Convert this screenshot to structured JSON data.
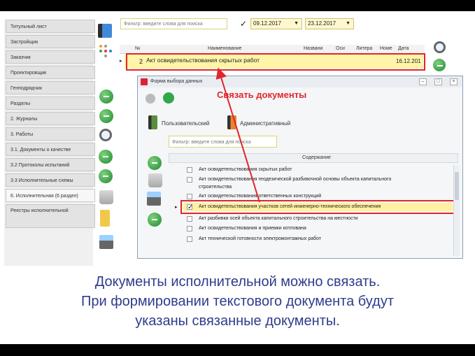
{
  "sidebar": {
    "items": [
      {
        "label": "Титульный лист"
      },
      {
        "label": "Застройщик"
      },
      {
        "label": "Заказчик"
      },
      {
        "label": "Проектировщик"
      },
      {
        "label": "Генподрядчик"
      },
      {
        "label": "Разделы"
      },
      {
        "label": "2. Журналы"
      },
      {
        "label": "3. Работы"
      },
      {
        "label": "3.1. Документы о качестве"
      },
      {
        "label": "3.2 Протоколы испытаний"
      },
      {
        "label": "3.3 Исполнительные схемы"
      },
      {
        "label": "6. Исполнительная (6 раздел)"
      },
      {
        "label": "Реестры исполнительной"
      }
    ]
  },
  "toolbar": {
    "filter_placeholder": "Фильтр: введите слова для поиска",
    "check_mark": "✓",
    "date_from": "09.12.2017",
    "date_to": "23.12.2017",
    "dropdown_arrow": "▼"
  },
  "grid": {
    "columns": [
      "№",
      "Наименование",
      "Названи",
      "Оси",
      "Литера",
      "Номе",
      "Дата"
    ],
    "row": {
      "marker": "▸",
      "num": "2",
      "name": "Акт освидетельствования скрытых работ",
      "date": "16.12.201"
    }
  },
  "modal": {
    "title": "Форма выбора данных",
    "win_buttons": [
      "–",
      "□",
      "×"
    ],
    "tab_user": "Пользовательский",
    "tab_admin": "Административный",
    "filter_placeholder": "Фильтр: введите слова для поиска",
    "column_header": "Содержание",
    "row_marker": "▸",
    "rows": [
      {
        "text": "Акт освидетельствования скрытых работ",
        "checked": false,
        "highlight": false
      },
      {
        "text": "Акт освидетельствования геодезической разбивочной основы объекта капитального",
        "checked": false,
        "highlight": false
      },
      {
        "text": "строительства",
        "checked": null,
        "highlight": false
      },
      {
        "text": "Акт освидетельствования ответственных конструкций",
        "checked": false,
        "highlight": false
      },
      {
        "text": "Акт освидетельствования участков сетей инженерно-технического обеспечения",
        "checked": true,
        "highlight": true
      },
      {
        "text": "Акт разбивки осей объекта капитального строительства на местности",
        "checked": false,
        "highlight": false
      },
      {
        "text": "Акт освидетельствования и приемки котлована",
        "checked": false,
        "highlight": false
      },
      {
        "text": "Акт технической готовности электромонтажных работ",
        "checked": false,
        "highlight": false
      }
    ]
  },
  "annotation": {
    "link_title": "Связать документы"
  },
  "caption": {
    "line1": "Документы исполнительной можно связать.",
    "line2": "При формировании текстового документа будут",
    "line3": "указаны связанные документы."
  },
  "colors": {
    "accent_red": "#e0262e",
    "highlight_yellow": "#fff1a0",
    "caption_blue": "#2f3c8c"
  }
}
